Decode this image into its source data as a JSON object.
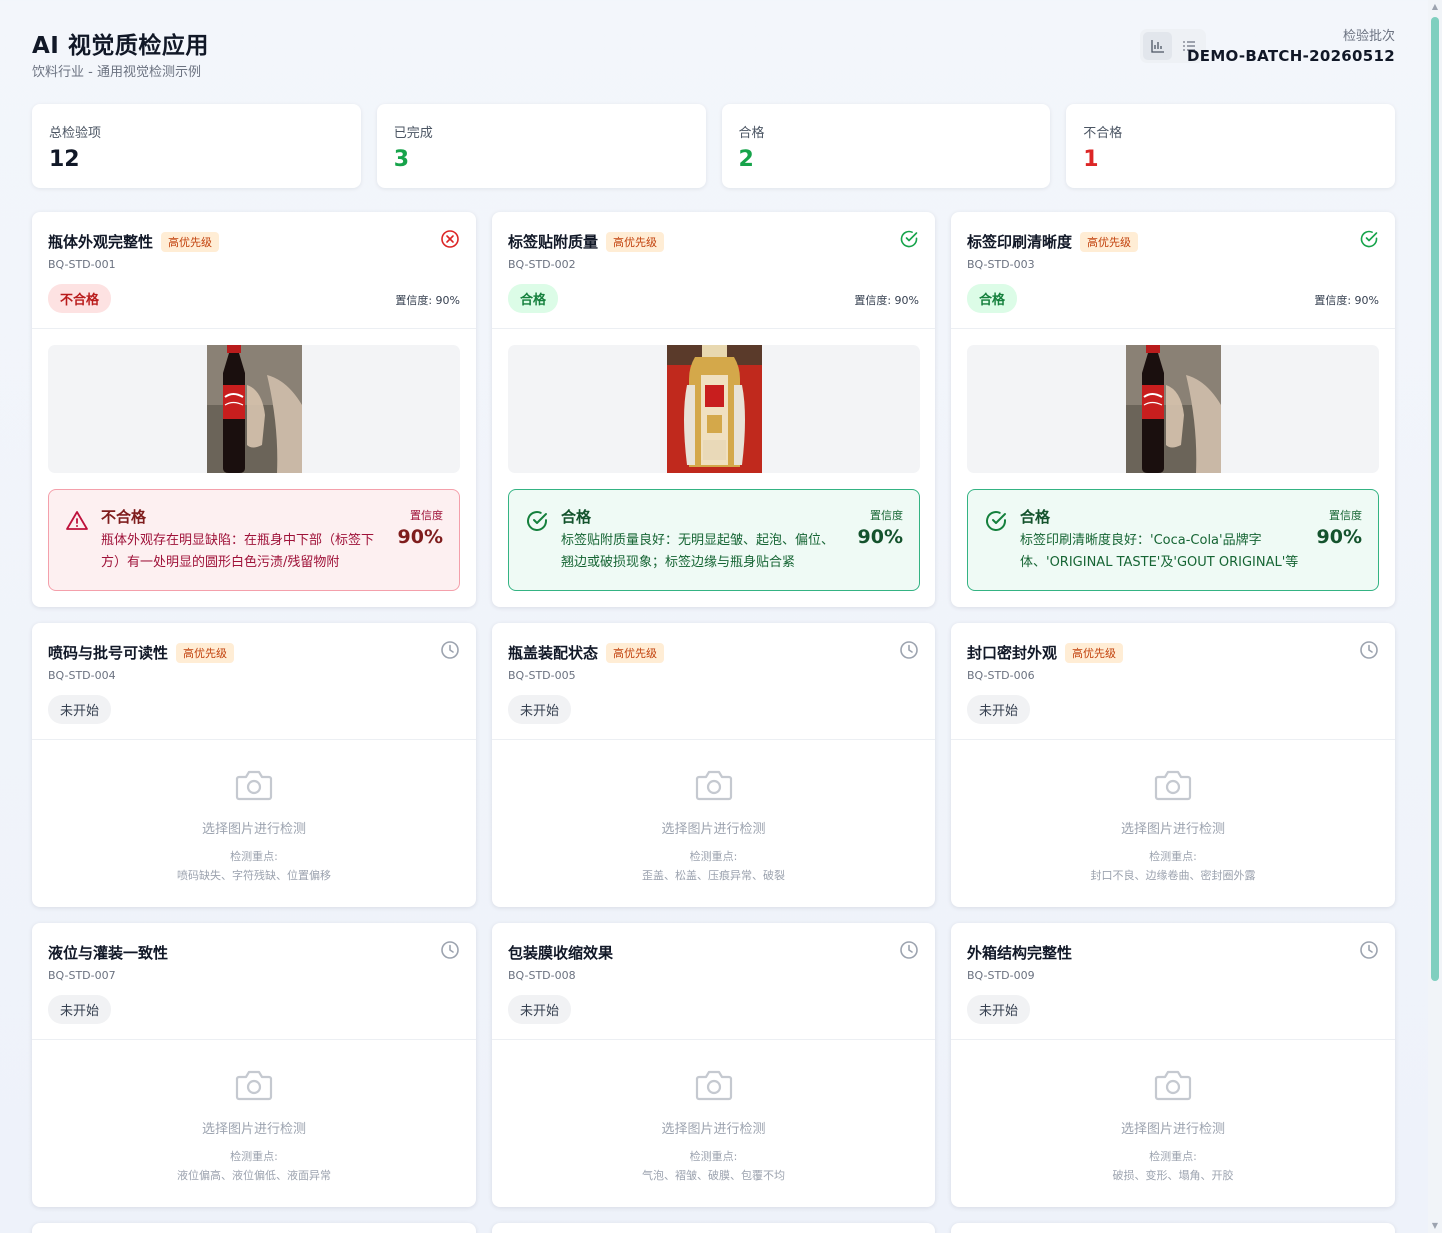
{
  "header": {
    "title": "AI 视觉质检应用",
    "subtitle": "饮料行业 - 通用视觉检测示例",
    "batch_label": "检验批次",
    "batch_value": "DEMO-BATCH-20260512",
    "view_modes": [
      "chart-view",
      "list-view"
    ]
  },
  "stats": [
    {
      "label": "总检验项",
      "value": "12",
      "color": "#111827"
    },
    {
      "label": "已完成",
      "value": "3",
      "color": "#16a34a"
    },
    {
      "label": "合格",
      "value": "2",
      "color": "#16a34a"
    },
    {
      "label": "不合格",
      "value": "1",
      "color": "#dc2626"
    }
  ],
  "colors": {
    "fail": "#dc2626",
    "pass": "#16a34a",
    "priority_bg": "#ffedd5",
    "priority_text": "#c2410c"
  },
  "cards": [
    {
      "title": "瓶体外观完整性",
      "priority": "高优先级",
      "code": "BQ-STD-001",
      "state": "fail",
      "status": "不合格",
      "confidence_small": "置信度: 90%",
      "icon": "x-circle-icon",
      "image": "coca-cola-bottle",
      "result": {
        "title": "不合格",
        "text": "瓶体外观存在明显缺陷：在瓶身中下部（标签下方）有一处明显的圆形白色污渍/残留物附",
        "conf_label": "置信度",
        "conf_value": "90%",
        "icon": "warning-icon"
      }
    },
    {
      "title": "标签贴附质量",
      "priority": "高优先级",
      "code": "BQ-STD-002",
      "state": "pass",
      "status": "合格",
      "confidence_small": "置信度: 90%",
      "icon": "check-circle-icon",
      "image": "dongpeng-bottle",
      "result": {
        "title": "合格",
        "text": "标签贴附质量良好：无明显起皱、起泡、偏位、翘边或破损现象；标签边缘与瓶身贴合紧",
        "conf_label": "置信度",
        "conf_value": "90%",
        "icon": "check-circle-icon"
      }
    },
    {
      "title": "标签印刷清晰度",
      "priority": "高优先级",
      "code": "BQ-STD-003",
      "state": "pass",
      "status": "合格",
      "confidence_small": "置信度: 90%",
      "icon": "check-circle-icon",
      "image": "coca-cola-bottle",
      "result": {
        "title": "合格",
        "text": "标签印刷清晰度良好：'Coca-Cola'品牌字体、'ORIGINAL TASTE'及'GOUT ORIGINAL'等文",
        "conf_label": "置信度",
        "conf_value": "90%",
        "icon": "check-circle-icon"
      }
    },
    {
      "title": "喷码与批号可读性",
      "priority": "高优先级",
      "code": "BQ-STD-004",
      "state": "pending",
      "status": "未开始",
      "icon": "clock-icon",
      "upload_label": "选择图片进行检测",
      "focus_label": "检测重点:",
      "focus_items": "喷码缺失、字符残缺、位置偏移"
    },
    {
      "title": "瓶盖装配状态",
      "priority": "高优先级",
      "code": "BQ-STD-005",
      "state": "pending",
      "status": "未开始",
      "icon": "clock-icon",
      "upload_label": "选择图片进行检测",
      "focus_label": "检测重点:",
      "focus_items": "歪盖、松盖、压痕异常、破裂"
    },
    {
      "title": "封口密封外观",
      "priority": "高优先级",
      "code": "BQ-STD-006",
      "state": "pending",
      "status": "未开始",
      "icon": "clock-icon",
      "upload_label": "选择图片进行检测",
      "focus_label": "检测重点:",
      "focus_items": "封口不良、边缘卷曲、密封圈外露"
    },
    {
      "title": "液位与灌装一致性",
      "priority": "",
      "code": "BQ-STD-007",
      "state": "pending",
      "status": "未开始",
      "icon": "clock-icon",
      "upload_label": "选择图片进行检测",
      "focus_label": "检测重点:",
      "focus_items": "液位偏高、液位偏低、液面异常"
    },
    {
      "title": "包装膜收缩效果",
      "priority": "",
      "code": "BQ-STD-008",
      "state": "pending",
      "status": "未开始",
      "icon": "clock-icon",
      "upload_label": "选择图片进行检测",
      "focus_label": "检测重点:",
      "focus_items": "气泡、褶皱、破膜、包覆不均"
    },
    {
      "title": "外箱结构完整性",
      "priority": "",
      "code": "BQ-STD-009",
      "state": "pending",
      "status": "未开始",
      "icon": "clock-icon",
      "upload_label": "选择图片进行检测",
      "focus_label": "检测重点:",
      "focus_items": "破损、变形、塌角、开胶"
    }
  ]
}
